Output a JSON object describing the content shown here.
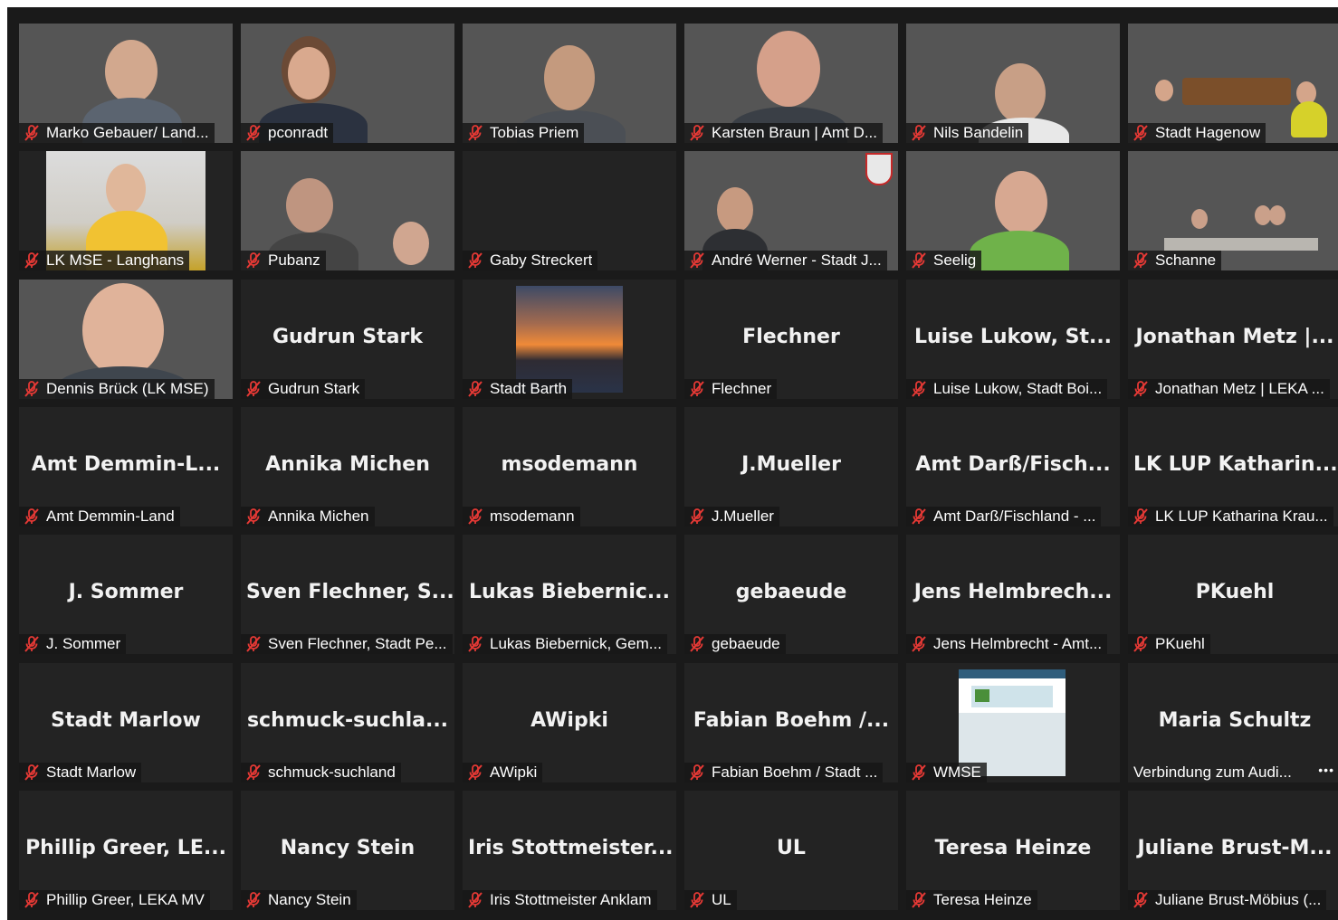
{
  "participants": [
    {
      "label": "Marko Gebauer/ Land...",
      "big": "",
      "video": true
    },
    {
      "label": "pconradt",
      "big": "",
      "video": true
    },
    {
      "label": "Tobias Priem",
      "big": "",
      "video": true
    },
    {
      "label": "Karsten Braun | Amt D...",
      "big": "",
      "video": true
    },
    {
      "label": "Nils Bandelin",
      "big": "",
      "video": true
    },
    {
      "label": "Stadt Hagenow",
      "big": "",
      "video": true
    },
    {
      "label": "LK MSE - Langhans",
      "big": "",
      "video": true
    },
    {
      "label": "Pubanz",
      "big": "",
      "video": true
    },
    {
      "label": "Gaby Streckert",
      "big": "",
      "video": false
    },
    {
      "label": "André Werner - Stadt J...",
      "big": "",
      "video": true
    },
    {
      "label": "Seelig",
      "big": "",
      "video": true
    },
    {
      "label": "Schanne",
      "big": "",
      "video": true
    },
    {
      "label": "Dennis Brück (LK MSE)",
      "big": "",
      "video": true
    },
    {
      "label": "Gudrun Stark",
      "big": "Gudrun Stark",
      "video": false
    },
    {
      "label": "Stadt Barth",
      "big": "",
      "video": false
    },
    {
      "label": "Flechner",
      "big": "Flechner",
      "video": false
    },
    {
      "label": "Luise Lukow, Stadt Boi...",
      "big": "Luise Lukow, St...",
      "video": false
    },
    {
      "label": "Jonathan Metz | LEKA ...",
      "big": "Jonathan Metz |...",
      "video": false
    },
    {
      "label": "Amt Demmin-Land",
      "big": "Amt Demmin-L...",
      "video": false
    },
    {
      "label": "Annika Michen",
      "big": "Annika Michen",
      "video": false
    },
    {
      "label": "msodemann",
      "big": "msodemann",
      "video": false
    },
    {
      "label": "J.Mueller",
      "big": "J.Mueller",
      "video": false
    },
    {
      "label": "Amt Darß/Fischland - ...",
      "big": "Amt Darß/Fisch...",
      "video": false
    },
    {
      "label": "LK LUP Katharina Krau...",
      "big": "LK LUP Katharin...",
      "video": false
    },
    {
      "label": "J. Sommer",
      "big": "J. Sommer",
      "video": false
    },
    {
      "label": "Sven Flechner, Stadt Pe...",
      "big": "Sven Flechner, S...",
      "video": false
    },
    {
      "label": "Lukas Biebernick, Gem...",
      "big": "Lukas Biebernic...",
      "video": false
    },
    {
      "label": "gebaeude",
      "big": "gebaeude",
      "video": false
    },
    {
      "label": "Jens Helmbrecht - Amt...",
      "big": "Jens Helmbrech...",
      "video": false
    },
    {
      "label": "PKuehl",
      "big": "PKuehl",
      "video": false
    },
    {
      "label": "Stadt Marlow",
      "big": "Stadt Marlow",
      "video": false
    },
    {
      "label": "schmuck-suchland",
      "big": "schmuck-suchla...",
      "video": false
    },
    {
      "label": "AWipki",
      "big": "AWipki",
      "video": false
    },
    {
      "label": "Fabian Boehm / Stadt ...",
      "big": "Fabian Boehm /...",
      "video": false
    },
    {
      "label": "WMSE",
      "big": "",
      "video": false
    },
    {
      "label": "Verbindung zum Audi...",
      "big": "Maria Schultz",
      "video": false
    },
    {
      "label": "Phillip Greer, LEKA MV",
      "big": "Phillip Greer, LE...",
      "video": false
    },
    {
      "label": "Nancy Stein",
      "big": "Nancy Stein",
      "video": false
    },
    {
      "label": "Iris Stottmeister Anklam",
      "big": "Iris Stottmeister...",
      "video": false
    },
    {
      "label": "UL",
      "big": "UL",
      "video": false
    },
    {
      "label": "Teresa Heinze",
      "big": "Teresa Heinze",
      "video": false
    },
    {
      "label": "Juliane Brust-Möbius (...",
      "big": "Juliane Brust-M...",
      "video": false
    }
  ],
  "icons": {
    "muted": "muted-mic-icon",
    "more": "more-options-icon"
  },
  "colors": {
    "muted_red": "#e53935",
    "tile_bg": "#232323",
    "app_bg": "#1a1a1a"
  }
}
